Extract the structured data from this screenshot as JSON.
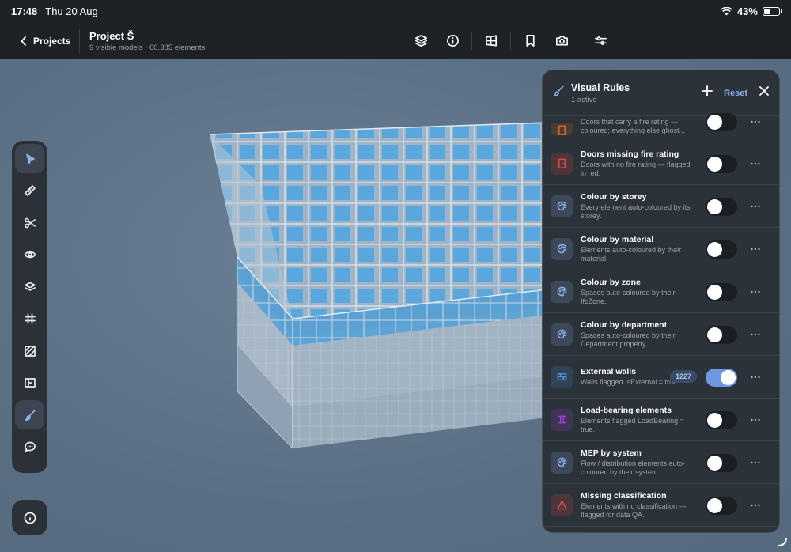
{
  "status": {
    "time": "17:48",
    "date": "Thu 20 Aug",
    "battery": "43%",
    "battery_level": 0.43
  },
  "toolbar": {
    "back_label": "Projects",
    "project_title": "Project Š",
    "project_subtitle": "9 visible models · 60.385 elements",
    "tools": [
      "layers-icon",
      "info-icon",
      "section-box-icon",
      "bookmark-icon",
      "camera-icon",
      "sliders-icon"
    ]
  },
  "rail": {
    "tools": [
      "select-arrow-icon",
      "measure-ruler-icon",
      "scissors-icon",
      "eye-icon",
      "layers-icon",
      "grid-icon",
      "hatch-icon",
      "floorplan-icon",
      "paint-brush-icon",
      "comment-icon"
    ],
    "active": "paint-brush-icon"
  },
  "panel": {
    "title": "Visual Rules",
    "subtitle": "1 active",
    "reset_label": "Reset",
    "rules": [
      {
        "name": "",
        "desc": "Doors that carry a fire rating — coloured; everything else ghost...",
        "icon": "door-icon",
        "color": "#e06a2a",
        "on": false
      },
      {
        "name": "Doors missing fire rating",
        "desc": "Doors with no fire rating — flagged in red.",
        "icon": "door-icon",
        "color": "#e04848",
        "on": false
      },
      {
        "name": "Colour by storey",
        "desc": "Every element auto-coloured by its storey.",
        "icon": "palette-icon",
        "color": "#8ab0ea",
        "on": false
      },
      {
        "name": "Colour by material",
        "desc": "Elements auto-coloured by their material.",
        "icon": "palette-icon",
        "color": "#8ab0ea",
        "on": false
      },
      {
        "name": "Colour by zone",
        "desc": "Spaces auto-coloured by their IfcZone.",
        "icon": "palette-icon",
        "color": "#8ab0ea",
        "on": false
      },
      {
        "name": "Colour by department",
        "desc": "Spaces auto-coloured by their Department property.",
        "icon": "palette-icon",
        "color": "#8ab0ea",
        "on": false
      },
      {
        "name": "External walls",
        "desc": "Walls flagged IsExternal = true.",
        "icon": "wall-icon",
        "color": "#4a8fe0",
        "on": true,
        "badge": "1227"
      },
      {
        "name": "Load-bearing elements",
        "desc": "Elements flagged LoadBearing = true.",
        "icon": "column-icon",
        "color": "#9a3fd0",
        "on": false
      },
      {
        "name": "MEP by system",
        "desc": "Flow / distribution elements auto-coloured by their system.",
        "icon": "palette-icon",
        "color": "#8ab0ea",
        "on": false
      },
      {
        "name": "Missing classification",
        "desc": "Elements with no classification — flagged for data QA.",
        "icon": "warning-icon",
        "color": "#e04848",
        "on": false
      }
    ]
  }
}
